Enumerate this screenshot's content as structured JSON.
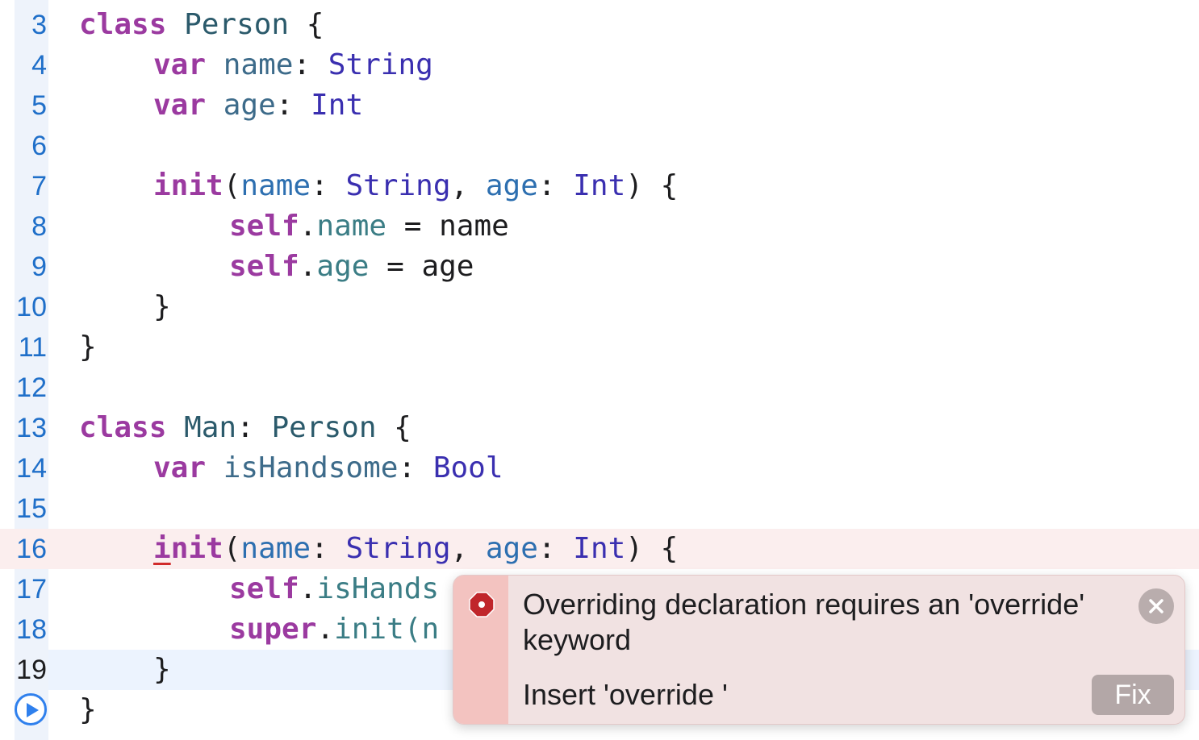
{
  "editor": {
    "line_numbers": [
      "3",
      "4",
      "5",
      "6",
      "7",
      "8",
      "9",
      "10",
      "11",
      "12",
      "13",
      "14",
      "15",
      "16",
      "17",
      "18",
      "19"
    ],
    "l3": {
      "kw": "class",
      "name": "Person",
      "rest": " {"
    },
    "l4": {
      "kw": "var",
      "name": "name",
      "colon": ": ",
      "type": "String"
    },
    "l5": {
      "kw": "var",
      "name": "age",
      "colon": ": ",
      "type": "Int"
    },
    "l7": {
      "kw": "init",
      "p1": "name",
      "c1": ": ",
      "t1": "String",
      "sep": ", ",
      "p2": "age",
      "c2": ": ",
      "t2": "Int",
      "end": ") {"
    },
    "l8": {
      "self": "self",
      "dot": ".",
      "prop": "name",
      "rest": " = name"
    },
    "l9": {
      "self": "self",
      "dot": ".",
      "prop": "age",
      "rest": " = age"
    },
    "l10": "}",
    "l11": "}",
    "l13": {
      "kw": "class",
      "name": "Man",
      "colon": ": ",
      "super": "Person",
      "rest": " {"
    },
    "l14": {
      "kw": "var",
      "name": "isHandsome",
      "colon": ": ",
      "type": "Bool"
    },
    "l16": {
      "kw_first": "i",
      "kw_rest": "nit",
      "p1": "name",
      "c1": ": ",
      "t1": "String",
      "sep": ", ",
      "p2": "age",
      "c2": ": ",
      "t2": "Int",
      "end": ") {"
    },
    "l17": {
      "self": "self",
      "dot": ".",
      "prop": "isHands"
    },
    "l18": {
      "super": "super",
      "dot": ".",
      "method": "init",
      "rest": "(n"
    },
    "l19": "}",
    "l20": "}"
  },
  "issue": {
    "message": "Overriding declaration requires an 'override' keyword",
    "fix_description": "Insert 'override '",
    "fix_label": "Fix"
  },
  "icons": {
    "error": "error-icon",
    "close": "close-icon",
    "run": "run-icon"
  },
  "colors": {
    "keyword": "#9b3aa0",
    "type": "#3a2fb0",
    "line_number": "#1f6fc9",
    "error_line_bg": "#fbeeee",
    "current_line_bg": "#ecf3fe",
    "error_red": "#c0262b"
  }
}
